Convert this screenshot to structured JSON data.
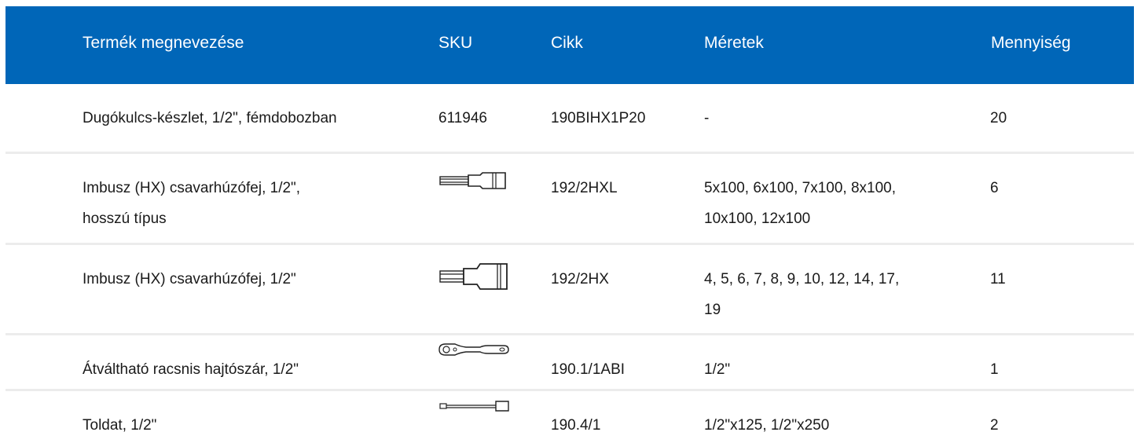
{
  "table": {
    "headers": {
      "name": "Termék megnevezése",
      "sku": "SKU",
      "cikk": "Cikk",
      "sizes": "Méretek",
      "qty": "Mennyiség"
    },
    "rows": [
      {
        "name_lines": [
          "Dugókulcs-készlet, 1/2\", fémdobozban"
        ],
        "sku": "611946",
        "sku_icon": null,
        "cikk": "190BIHX1P20",
        "size_lines": [
          "-"
        ],
        "qty": "20"
      },
      {
        "name_lines": [
          "Imbusz (HX) csavarhúzófej, 1/2\",",
          "hosszú típus"
        ],
        "sku": "",
        "sku_icon": "long-hex-bit-socket-icon",
        "cikk": "192/2HXL",
        "size_lines": [
          "5x100, 6x100, 7x100, 8x100,",
          "10x100, 12x100"
        ],
        "qty": "6"
      },
      {
        "name_lines": [
          "Imbusz (HX) csavarhúzófej, 1/2\""
        ],
        "sku": "",
        "sku_icon": "hex-bit-socket-icon",
        "cikk": "192/2HX",
        "size_lines": [
          "4, 5, 6, 7, 8, 9, 10, 12, 14, 17,",
          "19"
        ],
        "qty": "11"
      },
      {
        "name_lines": [
          "Átváltható racsnis hajtószár, 1/2\""
        ],
        "sku": "",
        "sku_icon": "ratchet-icon",
        "cikk": "190.1/1ABI",
        "size_lines": [
          "1/2\""
        ],
        "qty": "1"
      },
      {
        "name_lines": [
          "Toldat, 1/2\""
        ],
        "sku": "",
        "sku_icon": "extension-bar-icon",
        "cikk": "190.4/1",
        "size_lines": [
          "1/2\"x125, 1/2\"x250"
        ],
        "qty": "2"
      }
    ]
  },
  "colors": {
    "header_bg": "#0066b8",
    "header_text": "#ffffff",
    "row_divider": "#ececec",
    "body_text": "#1a1a1a"
  }
}
